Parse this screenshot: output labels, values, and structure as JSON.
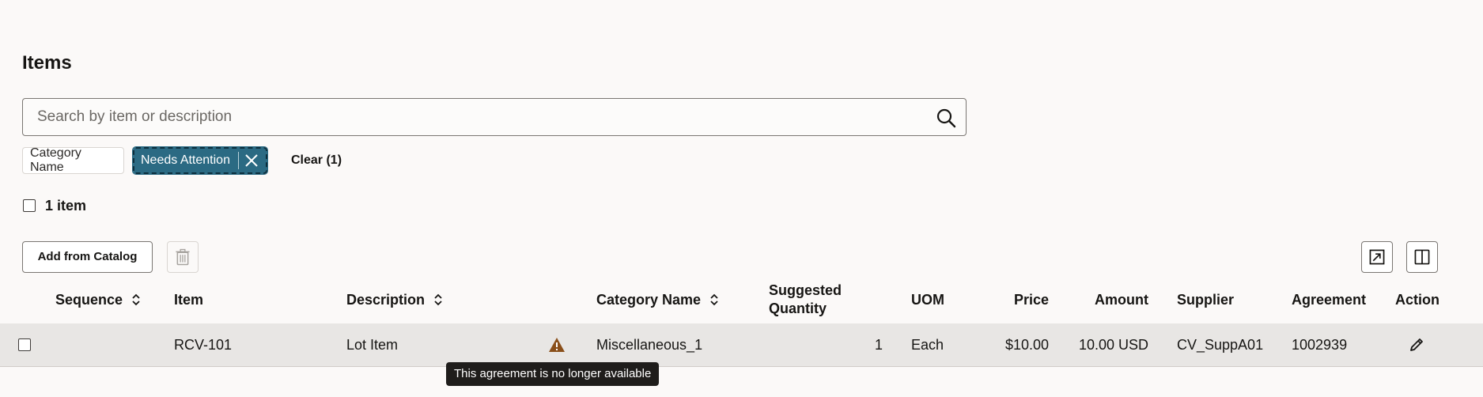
{
  "page": {
    "title": "Items"
  },
  "search": {
    "placeholder": "Search by item or description",
    "value": ""
  },
  "filters": {
    "chips": [
      {
        "label": "Category Name",
        "selected": false
      },
      {
        "label": "Needs Attention",
        "selected": true
      }
    ],
    "clear_label": "Clear (1)"
  },
  "selection": {
    "count_label": "1 item"
  },
  "toolbar": {
    "add_label": "Add from Catalog"
  },
  "table": {
    "headers": {
      "sequence": "Sequence",
      "item": "Item",
      "description": "Description",
      "category_name": "Category Name",
      "suggested_quantity_1": "Suggested",
      "suggested_quantity_2": "Quantity",
      "uom": "UOM",
      "price": "Price",
      "amount": "Amount",
      "supplier": "Supplier",
      "agreement": "Agreement",
      "action": "Action"
    },
    "rows": [
      {
        "sequence": "",
        "item": "RCV-101",
        "description": "Lot Item",
        "category_name": "Miscellaneous_1",
        "suggested_quantity": "1",
        "uom": "Each",
        "price": "$10.00",
        "amount": "10.00 USD",
        "supplier": "CV_SuppA01",
        "agreement": "1002939",
        "warning_icon": "warning-icon",
        "action_icon": "pencil-icon"
      }
    ]
  },
  "tooltip": {
    "text": "This agreement is no longer available"
  },
  "colors": {
    "accent": "#2b6a83",
    "warning": "#8a4f1a",
    "row_bg": "#e8e6e4"
  }
}
